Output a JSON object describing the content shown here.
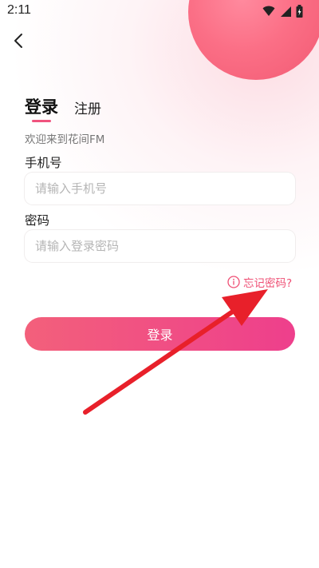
{
  "status_bar": {
    "time": "2:11",
    "icons": [
      "wifi-icon",
      "signal-icon",
      "battery-icon"
    ]
  },
  "nav": {
    "back_icon": "chevron-left-icon"
  },
  "tabs": {
    "login": "登录",
    "register": "注册"
  },
  "welcome": "欢迎来到花间FM",
  "phone": {
    "label": "手机号",
    "placeholder": "请输入手机号",
    "value": ""
  },
  "password": {
    "label": "密码",
    "placeholder": "请输入登录密码",
    "value": ""
  },
  "forgot": {
    "icon": "info-circle-icon",
    "label": "忘记密码?"
  },
  "login_button": {
    "label": "登录"
  },
  "colors": {
    "accent": "#f0537e",
    "button_start": "#f3607b",
    "button_end": "#ee3f8c",
    "arrow": "#e8202a",
    "circle": "#fb6f86"
  }
}
